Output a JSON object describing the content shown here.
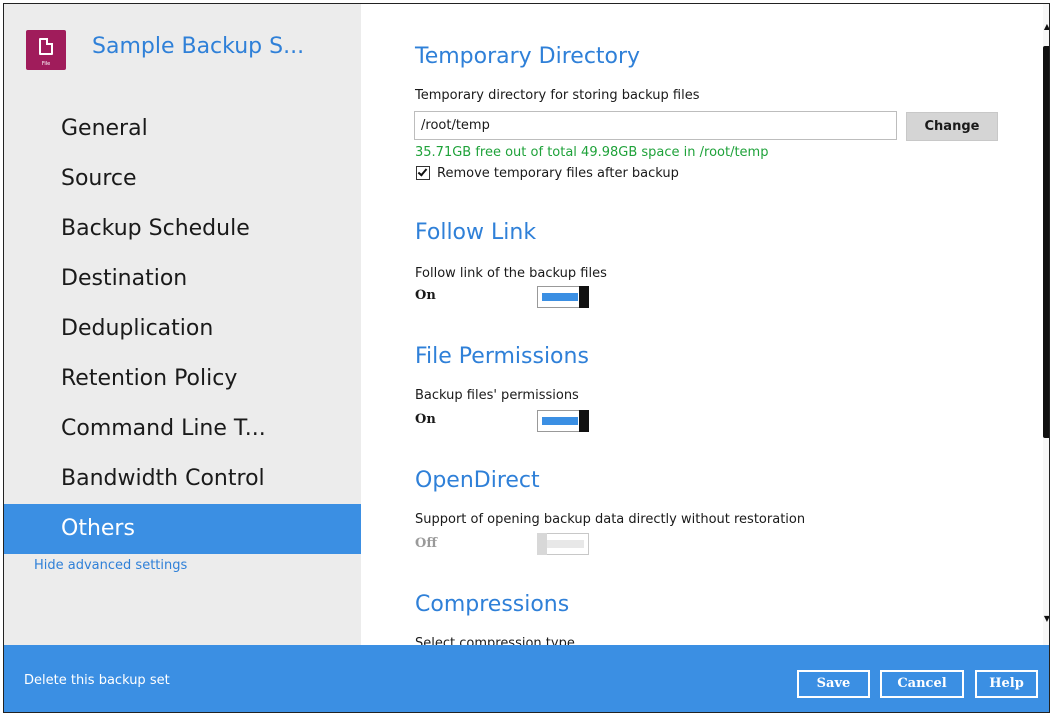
{
  "app": {
    "title": "Sample Backup S...",
    "icon_tag": "File",
    "icon": "file-document-icon",
    "accent_color": "#3b8fe3",
    "icon_color": "#a01c5b"
  },
  "sidebar": {
    "items": [
      {
        "label": "General"
      },
      {
        "label": "Source"
      },
      {
        "label": "Backup Schedule"
      },
      {
        "label": "Destination"
      },
      {
        "label": "Deduplication"
      },
      {
        "label": "Retention Policy"
      },
      {
        "label": "Command Line T..."
      },
      {
        "label": "Bandwidth Control"
      },
      {
        "label": "Others",
        "active": true
      }
    ],
    "hide_advanced": "Hide advanced settings"
  },
  "main": {
    "temp_dir": {
      "title": "Temporary Directory",
      "label": "Temporary directory for storing backup files",
      "path_value": "/root/temp",
      "change_label": "Change",
      "free_space": "35.71GB free out of total 49.98GB space in /root/temp",
      "remove_label": "Remove temporary files after backup",
      "remove_checked": true
    },
    "follow_link": {
      "title": "Follow Link",
      "label": "Follow link of the backup files",
      "state": "On"
    },
    "file_permissions": {
      "title": "File Permissions",
      "label": "Backup files' permissions",
      "state": "On"
    },
    "open_direct": {
      "title": "OpenDirect",
      "label": "Support of opening backup data directly without restoration",
      "state": "Off"
    },
    "compressions": {
      "title": "Compressions",
      "label": "Select compression type"
    }
  },
  "footer": {
    "delete_label": "Delete this backup set",
    "save_label": "Save",
    "cancel_label": "Cancel",
    "help_label": "Help"
  }
}
